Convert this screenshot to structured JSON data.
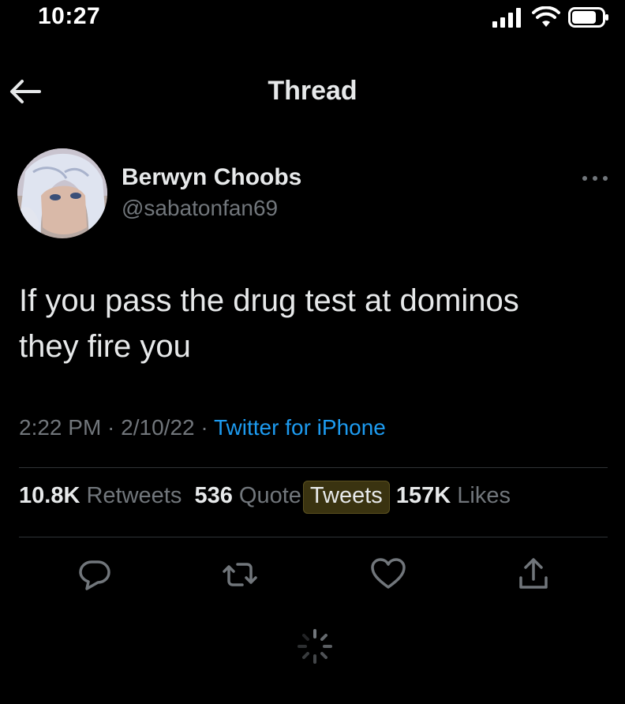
{
  "status_bar": {
    "time": "10:27"
  },
  "nav": {
    "title": "Thread",
    "back_icon": "arrow-left-icon"
  },
  "tweet": {
    "author": {
      "name": "Berwyn Choobs",
      "handle": "@sabatonfan69"
    },
    "text_line1": "If you pass the drug test at dominos",
    "text_line2": "they fire you",
    "meta": {
      "time": "2:22 PM",
      "sep1": " · ",
      "date": "2/10/22",
      "sep2": " · ",
      "source": "Twitter for iPhone"
    },
    "stats": {
      "retweets_count": "10.8K",
      "retweets_label": "Retweets",
      "quotes_count": "536",
      "quotes_label_a": "Quote",
      "quotes_label_b": "Tweets",
      "likes_count": "157K",
      "likes_label": "Likes"
    },
    "actions": [
      "reply-icon",
      "retweet-icon",
      "like-icon",
      "share-icon"
    ]
  },
  "colors": {
    "background": "#000000",
    "text": "#e7e9ea",
    "secondary": "#71767b",
    "link": "#1d9bf0",
    "highlight": "#3a3310"
  }
}
